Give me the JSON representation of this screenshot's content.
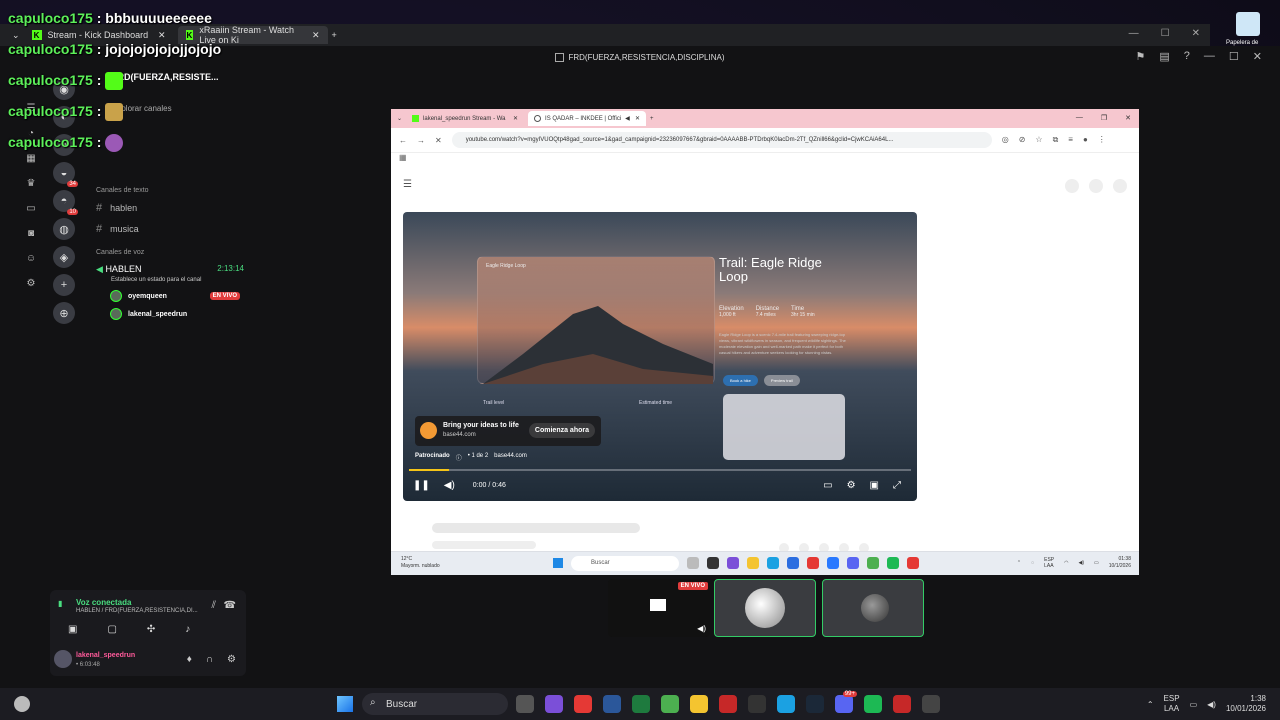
{
  "chat": [
    {
      "user": "capuloco175",
      "msg": "bbbuuuueeeeee"
    },
    {
      "user": "capuloco175",
      "msg": "jojojojojojojjojojo"
    },
    {
      "user": "capuloco175",
      "msg": ""
    },
    {
      "user": "capuloco175",
      "msg": ""
    },
    {
      "user": "capuloco175",
      "msg": ""
    }
  ],
  "outer_tabs": [
    {
      "label": "Stream - Kick Dashboard"
    },
    {
      "label": "xRaaiin Stream - Watch Live on Ki"
    }
  ],
  "discord": {
    "window_title": "FRD(FUERZA,RESISTENCIA,DISCIPLINA)",
    "server_name": "FRD(FUERZA,RESISTE...",
    "explore": "Explorar canales",
    "text_category": "Canales de texto",
    "text_channels": [
      "hablen",
      "musica"
    ],
    "voice_category": "Canales de voz",
    "voice_channel": "HABLEN",
    "voice_timer": "2:13:14",
    "voice_status": "Establece un estado para el canal",
    "voice_users": [
      {
        "name": "oyemqueen",
        "live": "EN VIVO"
      },
      {
        "name": "lakenal_speedrun",
        "live": ""
      }
    ],
    "server_badges": [
      "34",
      "10"
    ],
    "voice_connected": "Voz conectada",
    "voice_location": "HABLEN / FRD(FUERZA,RESISTENCIA,DI...",
    "user_name": "lakenal_speedrun",
    "user_time": "• 6:03:48"
  },
  "stream_browser": {
    "tabs": [
      {
        "label": "lakenal_speedrun Stream - Wa"
      },
      {
        "label": "IS QADAR – INKDEE | Offici"
      }
    ],
    "url": "youtube.com/watch?v=mgyIVUOQtp48gad_source=1&gad_campaignid=23236097667&gbraid=0AAAABB-PTDrbqK0lacDm-2Tf_QZnill66&gclid=CjwKCAiA64L...",
    "video": {
      "trail_title": "Trail: Eagle Ridge Loop",
      "card_label": "Eagle Ridge Loop",
      "stats": [
        {
          "label": "Elevation",
          "value": "1,000 ft"
        },
        {
          "label": "Distance",
          "value": "7.4 miles"
        },
        {
          "label": "Time",
          "value": "3hr 15 min"
        }
      ],
      "description": "Eagle Ridge Loop is a scenic 7.4-mile trail featuring sweeping ridge-top views, vibrant wildflowers in season, and frequent wildlife sightings. The moderate elevation gain and well-marked path make it perfect for both casual hikers and adventure seekers looking for stunning vistas.",
      "btn_primary": "Book a hike",
      "btn_secondary": "Preview trail",
      "trail_level": "Trail level",
      "estimated_time": "Estimated time",
      "ad_title": "Bring your ideas to life",
      "ad_site": "base44.com",
      "ad_cta": "Comienza ahora",
      "sponsor_label": "Patrocinado",
      "sponsor_count": "• 1 de 2",
      "sponsor_site": "base44.com",
      "time": "0:00 / 0:46",
      "progress": 0.08
    },
    "taskbar": {
      "temp": "12°C",
      "weather": "Mayorm. nublado",
      "search": "Buscar",
      "lang1": "ESP",
      "lang2": "LAA",
      "time": "01:38",
      "date": "10/1/2026"
    }
  },
  "tiles": [
    {
      "live": "EN VIVO"
    }
  ],
  "desktop": {
    "recycle_label": "Papelera de"
  },
  "taskbar": {
    "search": "Buscar",
    "lang1": "ESP",
    "lang2": "LAA",
    "time": "1:38",
    "date": "10/01/2026",
    "discord_badge": "99+"
  },
  "colors": {
    "accent_green": "#53fc18",
    "live_red": "#e03c3c",
    "chat_user": "#5df05a"
  }
}
